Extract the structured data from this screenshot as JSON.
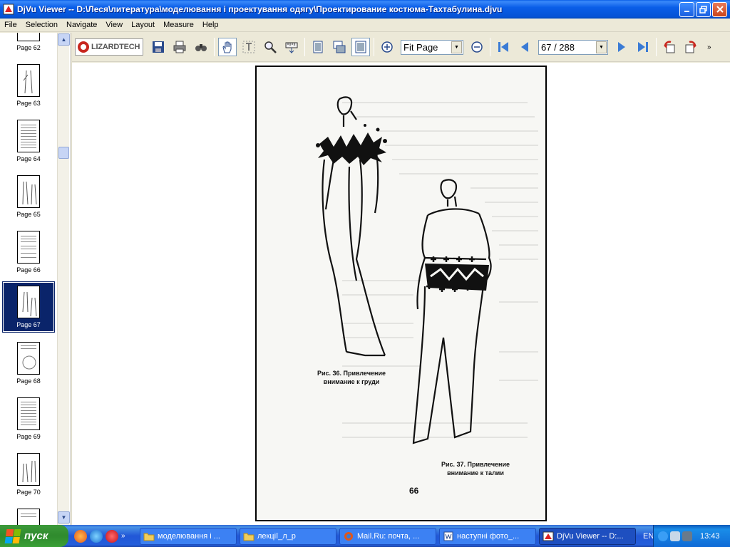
{
  "window": {
    "title": "DjVu Viewer -- D:\\Леся\\литература\\моделювання і проектування одягу\\Проектирование костюма-Тахтабулина.djvu"
  },
  "menu": [
    "File",
    "Selection",
    "Navigate",
    "View",
    "Layout",
    "Measure",
    "Help"
  ],
  "sidebar": {
    "thumbnails": [
      {
        "label": "Page 62",
        "selected": false
      },
      {
        "label": "Page 63",
        "selected": false
      },
      {
        "label": "Page 64",
        "selected": false
      },
      {
        "label": "Page 65",
        "selected": false
      },
      {
        "label": "Page 66",
        "selected": false
      },
      {
        "label": "Page 67",
        "selected": true
      },
      {
        "label": "Page 68",
        "selected": false
      },
      {
        "label": "Page 69",
        "selected": false
      },
      {
        "label": "Page 70",
        "selected": false
      }
    ],
    "scroll_up": "▲",
    "scroll_down": "▼"
  },
  "toolbar": {
    "logo_text": "LIZARDTECH",
    "zoom_value": "Fit Page",
    "page_value": "67 / 288",
    "more": "»"
  },
  "document": {
    "caption1": "Рис. 36. Привлечение\nвнимание к груди",
    "caption2": "Рис. 37. Привлечение\nвнимание к талии",
    "page_number": "66"
  },
  "taskbar": {
    "start_label": "пуск",
    "more": "»",
    "tasks": [
      {
        "label": "моделювання і ...",
        "active": false
      },
      {
        "label": "лекції_л_р",
        "active": false
      },
      {
        "label": "Mail.Ru: почта, ...",
        "active": false
      },
      {
        "label": "наступні фото_...",
        "active": false
      },
      {
        "label": "DjVu Viewer -- D:...",
        "active": true
      }
    ],
    "lang": "EN",
    "time": "13:43"
  },
  "colors": {
    "title_blue": "#0a5ee8",
    "selection_navy": "#0a246a",
    "taskbar_blue": "#245edb",
    "start_green": "#3c9a3a"
  }
}
